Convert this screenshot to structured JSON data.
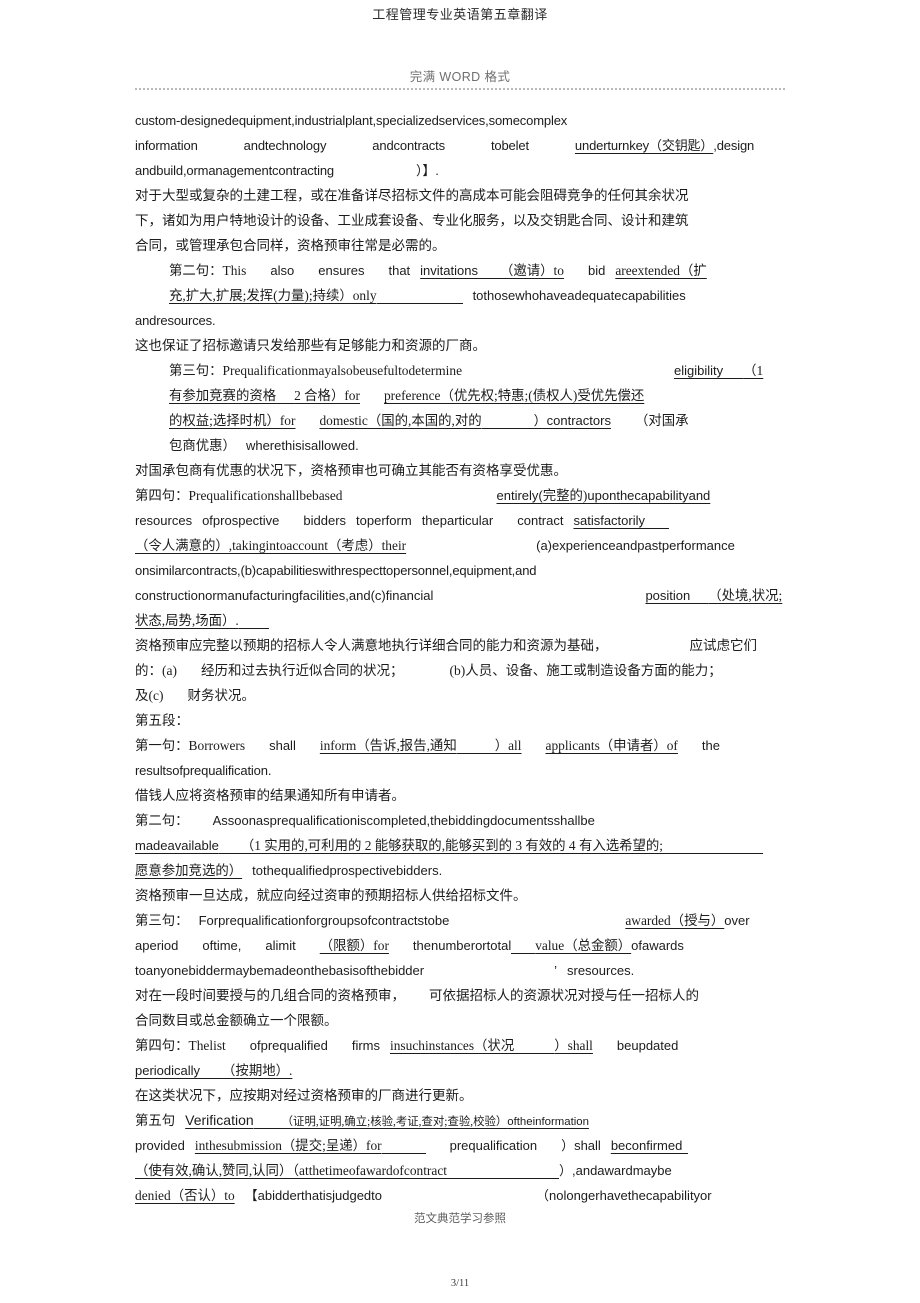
{
  "header": {
    "title": "工程管理专业英语第五章翻译",
    "watermark": "完满 WORD 格式"
  },
  "footer": {
    "note": "范文典范学习参照",
    "page_number": "3/11"
  },
  "lines": [
    {
      "id": "l01",
      "text": "custom-designedequipment,industrialplant,specializedservices,somecomplex"
    },
    {
      "id": "l02a",
      "text": "information"
    },
    {
      "id": "l02b",
      "text": "andtechnology"
    },
    {
      "id": "l02c",
      "text": "andcontracts"
    },
    {
      "id": "l02d",
      "text": "tobelet"
    },
    {
      "id": "l02e",
      "text": "underturnkey（交钥匙）"
    },
    {
      "id": "l02f",
      "text": ",design"
    },
    {
      "id": "l03a",
      "text": "andbuild,ormanagementcontracting"
    },
    {
      "id": "l03b",
      "text": "）】."
    },
    {
      "id": "l04",
      "text": "对于大型或复杂的土建工程，或在准备详尽招标文件的高成本可能会阻碍竞争的任何其余状况"
    },
    {
      "id": "l05",
      "text": "下，诸如为用户特地设计的设备、工业成套设备、专业化服务，以及交钥匙合同、设计和建筑"
    },
    {
      "id": "l06",
      "text": "合同，或管理承包合同样，资格预审往常是必需的。"
    },
    {
      "id": "l07a",
      "text": "第二句：This"
    },
    {
      "id": "l07b",
      "text": "also"
    },
    {
      "id": "l07c",
      "text": "ensures"
    },
    {
      "id": "l07d",
      "text": "that"
    },
    {
      "id": "l07e",
      "text": "invitations"
    },
    {
      "id": "l07f",
      "text": "（邀请）to"
    },
    {
      "id": "l07g",
      "text": "bid"
    },
    {
      "id": "l07h",
      "text": "areextended（扩"
    },
    {
      "id": "l08a",
      "text": "充,扩大,扩展;发挥(力量);持续）only"
    },
    {
      "id": "l08b",
      "text": "tothosewhohaveadequatecapabilities"
    },
    {
      "id": "l09",
      "text": "andresources."
    },
    {
      "id": "l10",
      "text": "这也保证了招标邀请只发给那些有足够能力和资源的厂商。"
    },
    {
      "id": "l11a",
      "text": "第三句：Prequalificationmayalsobeusefultodetermine"
    },
    {
      "id": "l11b",
      "text": "eligibility"
    },
    {
      "id": "l11c",
      "text": "（1"
    },
    {
      "id": "l12a",
      "text": "有参加竞赛的资格"
    },
    {
      "id": "l12b",
      "text": "2 合格）for"
    },
    {
      "id": "l12c",
      "text": "preference（优先权;特惠;(债权人)受优先偿还"
    },
    {
      "id": "l13a",
      "text": "的权益;选择时机）for"
    },
    {
      "id": "l13b",
      "text": "domestic（国的,本国的,对的"
    },
    {
      "id": "l13c",
      "text": "）contractors"
    },
    {
      "id": "l13d",
      "text": "（对国承"
    },
    {
      "id": "l14a",
      "text": "包商优惠）"
    },
    {
      "id": "l14b",
      "text": "wherethisisallowed."
    },
    {
      "id": "l15",
      "text": "对国承包商有优惠的状况下，资格预审也可确立其能否有资格享受优惠。"
    },
    {
      "id": "l16a",
      "text": "第四句：Prequalificationshallbebased"
    },
    {
      "id": "l16b",
      "text": "entirely("
    },
    {
      "id": "l16c",
      "text": "完整的)"
    },
    {
      "id": "l16d",
      "text": "uponthecapabilityand"
    },
    {
      "id": "l17a",
      "text": "resources"
    },
    {
      "id": "l17b",
      "text": "ofprospective"
    },
    {
      "id": "l17c",
      "text": "bidders"
    },
    {
      "id": "l17d",
      "text": "toperform"
    },
    {
      "id": "l17e",
      "text": "theparticular"
    },
    {
      "id": "l17f",
      "text": "contract"
    },
    {
      "id": "l17g",
      "text": "satisfactorily"
    },
    {
      "id": "l18a",
      "text": "（令人满意的）,takingintoaccount（考虑）their"
    },
    {
      "id": "l18b",
      "text": "(a)experienceandpastperformance"
    },
    {
      "id": "l19",
      "text": "onsimilarcontracts,(b)capabilitieswithrespecttopersonnel,equipment,and"
    },
    {
      "id": "l20a",
      "text": "constructionormanufacturingfacilities,and(c)financial"
    },
    {
      "id": "l20b",
      "text": "position"
    },
    {
      "id": "l20c",
      "text": "（处境,状况;"
    },
    {
      "id": "l21",
      "text": "状态,局势,场面）."
    },
    {
      "id": "l22a",
      "text": "资格预审应完整以预期的招标人令人满意地执行详细合同的能力和资源为基础，"
    },
    {
      "id": "l22b",
      "text": "应试虑它们"
    },
    {
      "id": "l23a",
      "text": "的：(a)"
    },
    {
      "id": "l23b",
      "text": "经历和过去执行近似合同的状况；"
    },
    {
      "id": "l23c",
      "text": "(b)人员、设备、施工或制造设备方面的能力；"
    },
    {
      "id": "l24a",
      "text": "及(c)"
    },
    {
      "id": "l24b",
      "text": "财务状况。"
    },
    {
      "id": "l25",
      "text": "第五段："
    },
    {
      "id": "l26a",
      "text": "第一句：Borrowers"
    },
    {
      "id": "l26b",
      "text": "shall"
    },
    {
      "id": "l26c",
      "text": "inform（告诉,报告,通知"
    },
    {
      "id": "l26d",
      "text": "）all"
    },
    {
      "id": "l26e",
      "text": "applicants（申请者）of"
    },
    {
      "id": "l26f",
      "text": "the"
    },
    {
      "id": "l27",
      "text": "resultsofprequalification."
    },
    {
      "id": "l28",
      "text": "借钱人应将资格预审的结果通知所有申请者。"
    },
    {
      "id": "l29a",
      "text": "第二句："
    },
    {
      "id": "l29b",
      "text": "Assoonasprequalificationiscompleted,thebiddingdocumentsshallbe"
    },
    {
      "id": "l30a",
      "text": "madeavailable"
    },
    {
      "id": "l30b",
      "text": "（1 实用的,可利用的 2 能够获取的,能够买到的 3 有效的 4 有入选希望的;"
    },
    {
      "id": "l31a",
      "text": "愿意参加竞选的）"
    },
    {
      "id": "l31b",
      "text": "tothequalifiedprospectivebidders."
    },
    {
      "id": "l32",
      "text": "资格预审一旦达成，就应向经过资审的预期招标人供给招标文件。"
    },
    {
      "id": "l33a",
      "text": "第三句："
    },
    {
      "id": "l33b",
      "text": "Forprequalificationforgroupsofcontractstobe"
    },
    {
      "id": "l33c",
      "text": "awarded（授与）"
    },
    {
      "id": "l33d",
      "text": "over"
    },
    {
      "id": "l34a",
      "text": "aperiod"
    },
    {
      "id": "l34b",
      "text": "oftime,"
    },
    {
      "id": "l34c",
      "text": "alimit"
    },
    {
      "id": "l34d",
      "text": "（限额）for"
    },
    {
      "id": "l34e",
      "text": "thenumberortotal"
    },
    {
      "id": "l34f",
      "text": "value（总金额）"
    },
    {
      "id": "l34g",
      "text": "ofawards"
    },
    {
      "id": "l35a",
      "text": "toanyonebiddermaybemadeonthebasisofthebidder"
    },
    {
      "id": "l35b",
      "text": "’"
    },
    {
      "id": "l35c",
      "text": "sresources."
    },
    {
      "id": "l36a",
      "text": "对在一段时间要授与的几组合同的资格预审，"
    },
    {
      "id": "l36b",
      "text": "可依据招标人的资源状况对授与任一招标人的"
    },
    {
      "id": "l37",
      "text": "合同数目或总金额确立一个限额。"
    },
    {
      "id": "l38a",
      "text": "第四句：Thelist"
    },
    {
      "id": "l38b",
      "text": "ofprequalified"
    },
    {
      "id": "l38c",
      "text": "firms"
    },
    {
      "id": "l38d",
      "text": "insuchinstances（状况"
    },
    {
      "id": "l38e",
      "text": "）shall"
    },
    {
      "id": "l38f",
      "text": "beupdated"
    },
    {
      "id": "l39a",
      "text": "periodically"
    },
    {
      "id": "l39b",
      "text": "（按期地）."
    },
    {
      "id": "l40",
      "text": "在这类状况下，应按期对经过资格预审的厂商进行更新。"
    },
    {
      "id": "l41a",
      "text": "第五句"
    },
    {
      "id": "l41b",
      "text": "Verification"
    },
    {
      "id": "l41c",
      "text": "（证明,证明,确立;核验,考证,查对;查验,校验）"
    },
    {
      "id": "l41d",
      "text": "oftheinformation"
    },
    {
      "id": "l42a",
      "text": "provided"
    },
    {
      "id": "l42b",
      "text": "inthesubmission（提交;呈递）for"
    },
    {
      "id": "l42c",
      "text": "prequalification"
    },
    {
      "id": "l42d",
      "text": "）shall"
    },
    {
      "id": "l42e",
      "text": "beconfirmed"
    },
    {
      "id": "l43a",
      "text": "（使有效,确认,赞同,认同）（atthetimeofawardofcontract"
    },
    {
      "id": "l43b",
      "text": "）,andawardmaybe"
    },
    {
      "id": "l44a",
      "text": "denied（否认）to"
    },
    {
      "id": "l44b",
      "text": "【abidderthatisjudgedto"
    },
    {
      "id": "l44c",
      "text": "（nolongerhavethecapabilityor"
    }
  ]
}
